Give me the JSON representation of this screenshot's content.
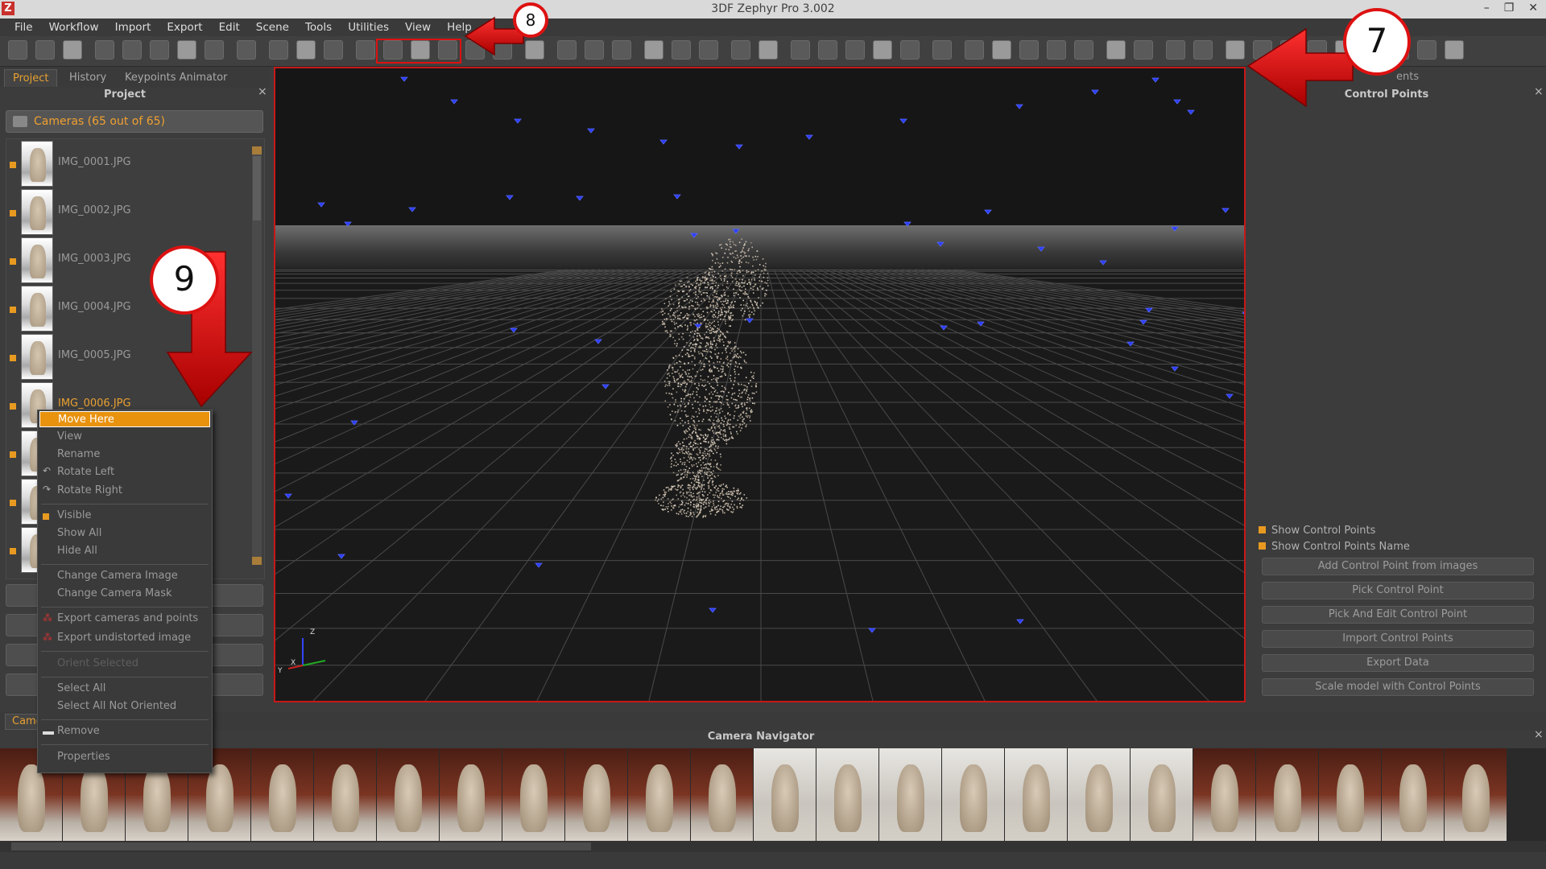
{
  "app": {
    "title": "3DF Zephyr Pro 3.002",
    "logo": "Z"
  },
  "window_buttons": [
    "–",
    "❐",
    "✕"
  ],
  "menu": [
    "File",
    "Workflow",
    "Import",
    "Export",
    "Edit",
    "Scene",
    "Tools",
    "Utilities",
    "View",
    "Help"
  ],
  "left_tabs": [
    "Project",
    "History",
    "Keypoints Animator"
  ],
  "project": {
    "title": "Project",
    "cameras_label": "Cameras (65 out of 65)",
    "images": [
      "IMG_0001.JPG",
      "IMG_0002.JPG",
      "IMG_0003.JPG",
      "IMG_0004.JPG",
      "IMG_0005.JPG",
      "IMG_0006.JPG"
    ]
  },
  "right_panel": {
    "tab_partial": "ents",
    "title": "Control Points",
    "checks": [
      "Show Control Points",
      "Show Control Points Name"
    ],
    "buttons": [
      "Add Control Point from images",
      "Pick Control Point",
      "Pick And Edit Control Point",
      "Import Control Points",
      "Export Data",
      "Scale model with Control Points"
    ]
  },
  "context_menu": {
    "items": [
      "Move Here",
      "View",
      "Rename",
      "Rotate Left",
      "Rotate Right",
      "Visible",
      "Show All",
      "Hide All",
      "Change Camera Image",
      "Change Camera Mask",
      "Export cameras and points",
      "Export undistorted image",
      "Orient Selected",
      "Select All",
      "Select All Not Oriented",
      "Remove",
      "Properties"
    ]
  },
  "bottom_tab_partial": "Came",
  "navigator": {
    "title": "Camera Navigator"
  },
  "axes": {
    "z": "Z",
    "x": "X",
    "y": "Y"
  },
  "callouts": {
    "c7": "7",
    "c8": "8",
    "c9": "9"
  },
  "colors": {
    "accent": "#e8a030",
    "highlight": "#c81818",
    "camera_markers": "#2a3cff"
  }
}
